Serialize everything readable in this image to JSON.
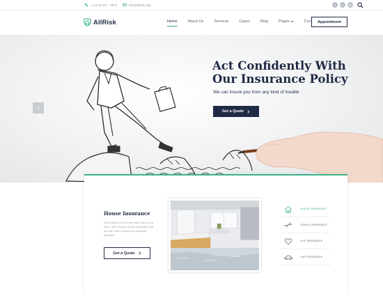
{
  "topbar": {
    "phone": "+1 (4 8) 967 - 5874",
    "email": "info@allrisk.org",
    "social": [
      "f",
      "t",
      "G+"
    ]
  },
  "header": {
    "logo": "AllRisk",
    "nav": [
      "Home",
      "About Us",
      "Services",
      "Cases",
      "Blog",
      "Pages",
      "Contacts"
    ],
    "active_nav": "Home",
    "appointment_label": "Appointment"
  },
  "hero": {
    "title": "Act Confidently With Our Insurance Policy",
    "subtitle": "We can insure you from any kind of trouble",
    "cta_label": "Get a Quote",
    "prev_arrow": "‹"
  },
  "card": {
    "title": "House Insurance",
    "text": "We protect you in more ways than you'd think. We'll include many coverages that do more than protect your physical structure.",
    "cta_label": "Get a Quote"
  },
  "insurance_types": [
    {
      "label": "HOUSE INSURANCE",
      "icon": "house-icon",
      "active": true
    },
    {
      "label": "TRAVEL INSURANCE",
      "icon": "plane-icon",
      "active": false
    },
    {
      "label": "LIFE INSURANCE",
      "icon": "heart-icon",
      "active": false
    },
    {
      "label": "CAR INSURANCE",
      "icon": "car-icon",
      "active": false
    }
  ],
  "colors": {
    "navy": "#1f2a44",
    "accent": "#3cb28a",
    "muted": "#9aa1ab"
  }
}
